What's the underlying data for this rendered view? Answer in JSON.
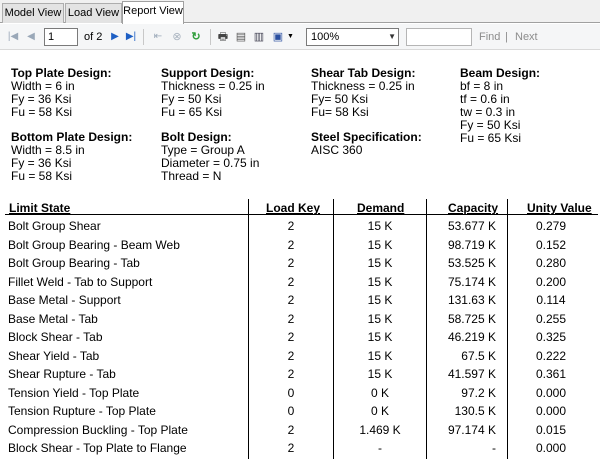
{
  "tabs": [
    {
      "label": "Model View"
    },
    {
      "label": "Load View"
    },
    {
      "label": "Report View"
    }
  ],
  "toolbar": {
    "page_value": "1",
    "page_of": "of 2",
    "zoom": "100%",
    "find_label": "Find",
    "separator": "|",
    "next_label": "Next",
    "icons": [
      "first-page-icon",
      "previous-page-icon",
      "next-page-icon",
      "last-page-icon",
      "back-icon",
      "stop-icon",
      "refresh-icon",
      "print-icon",
      "print-layout-icon",
      "page-setup-icon",
      "export-icon"
    ]
  },
  "design": {
    "top_plate": {
      "title": "Top Plate Design:",
      "lines": [
        "Width = 6 in",
        "Fy = 36 Ksi",
        "Fu = 58 Ksi"
      ]
    },
    "bottom_plate": {
      "title": "Bottom Plate Design:",
      "lines": [
        "Width = 8.5 in",
        "Fy = 36 Ksi",
        "Fu = 58 Ksi"
      ]
    },
    "support": {
      "title": "Support Design:",
      "lines": [
        "Thickness = 0.25 in",
        "Fy = 50 Ksi",
        "Fu = 65 Ksi"
      ]
    },
    "bolt": {
      "title": "Bolt Design:",
      "lines": [
        "Type  = Group A",
        "Diameter = 0.75 in",
        "Thread = N"
      ]
    },
    "shear_tab": {
      "title": "Shear Tab Design:",
      "lines": [
        "Thickness = 0.25 in",
        "Fy= 50 Ksi",
        "Fu= 58 Ksi"
      ]
    },
    "steel_spec": {
      "title": "Steel Specification:",
      "lines": [
        "AISC 360"
      ]
    },
    "beam": {
      "title": "Beam Design:",
      "lines": [
        "bf = 8 in",
        "tf = 0.6 in",
        "tw = 0.3 in",
        "Fy = 50 Ksi",
        "Fu = 65 Ksi"
      ]
    }
  },
  "table": {
    "headers": {
      "limit_state": "Limit State",
      "load_key": "Load Key",
      "demand": "Demand",
      "capacity": "Capacity",
      "unity": "Unity Value"
    },
    "rows": [
      {
        "name": "Bolt Group Shear",
        "key": "2",
        "demand": "15 K",
        "capacity": "53.677 K",
        "unity": "0.279"
      },
      {
        "name": "Bolt Group Bearing - Beam Web",
        "key": "2",
        "demand": "15 K",
        "capacity": "98.719 K",
        "unity": "0.152"
      },
      {
        "name": "Bolt Group Bearing - Tab",
        "key": "2",
        "demand": "15 K",
        "capacity": "53.525 K",
        "unity": "0.280"
      },
      {
        "name": "Fillet Weld - Tab to Support",
        "key": "2",
        "demand": "15 K",
        "capacity": "75.174 K",
        "unity": "0.200"
      },
      {
        "name": "Base Metal - Support",
        "key": "2",
        "demand": "15 K",
        "capacity": "131.63 K",
        "unity": "0.114"
      },
      {
        "name": "Base Metal - Tab",
        "key": "2",
        "demand": "15 K",
        "capacity": "58.725 K",
        "unity": "0.255"
      },
      {
        "name": "Block Shear - Tab",
        "key": "2",
        "demand": "15 K",
        "capacity": "46.219 K",
        "unity": "0.325"
      },
      {
        "name": "Shear Yield - Tab",
        "key": "2",
        "demand": "15 K",
        "capacity": "67.5 K",
        "unity": "0.222"
      },
      {
        "name": "Shear Rupture - Tab",
        "key": "2",
        "demand": "15 K",
        "capacity": "41.597 K",
        "unity": "0.361"
      },
      {
        "name": "Tension Yield - Top Plate",
        "key": "0",
        "demand": "0 K",
        "capacity": "97.2 K",
        "unity": "0.000"
      },
      {
        "name": "Tension Rupture - Top Plate",
        "key": "0",
        "demand": "0 K",
        "capacity": "130.5 K",
        "unity": "0.000"
      },
      {
        "name": "Compression Buckling - Top Plate",
        "key": "2",
        "demand": "1.469 K",
        "capacity": "97.174 K",
        "unity": "0.015"
      },
      {
        "name": "Block Shear - Top Plate to Flange",
        "key": "2",
        "demand": "-",
        "capacity": "-",
        "unity": "0.000"
      }
    ]
  }
}
